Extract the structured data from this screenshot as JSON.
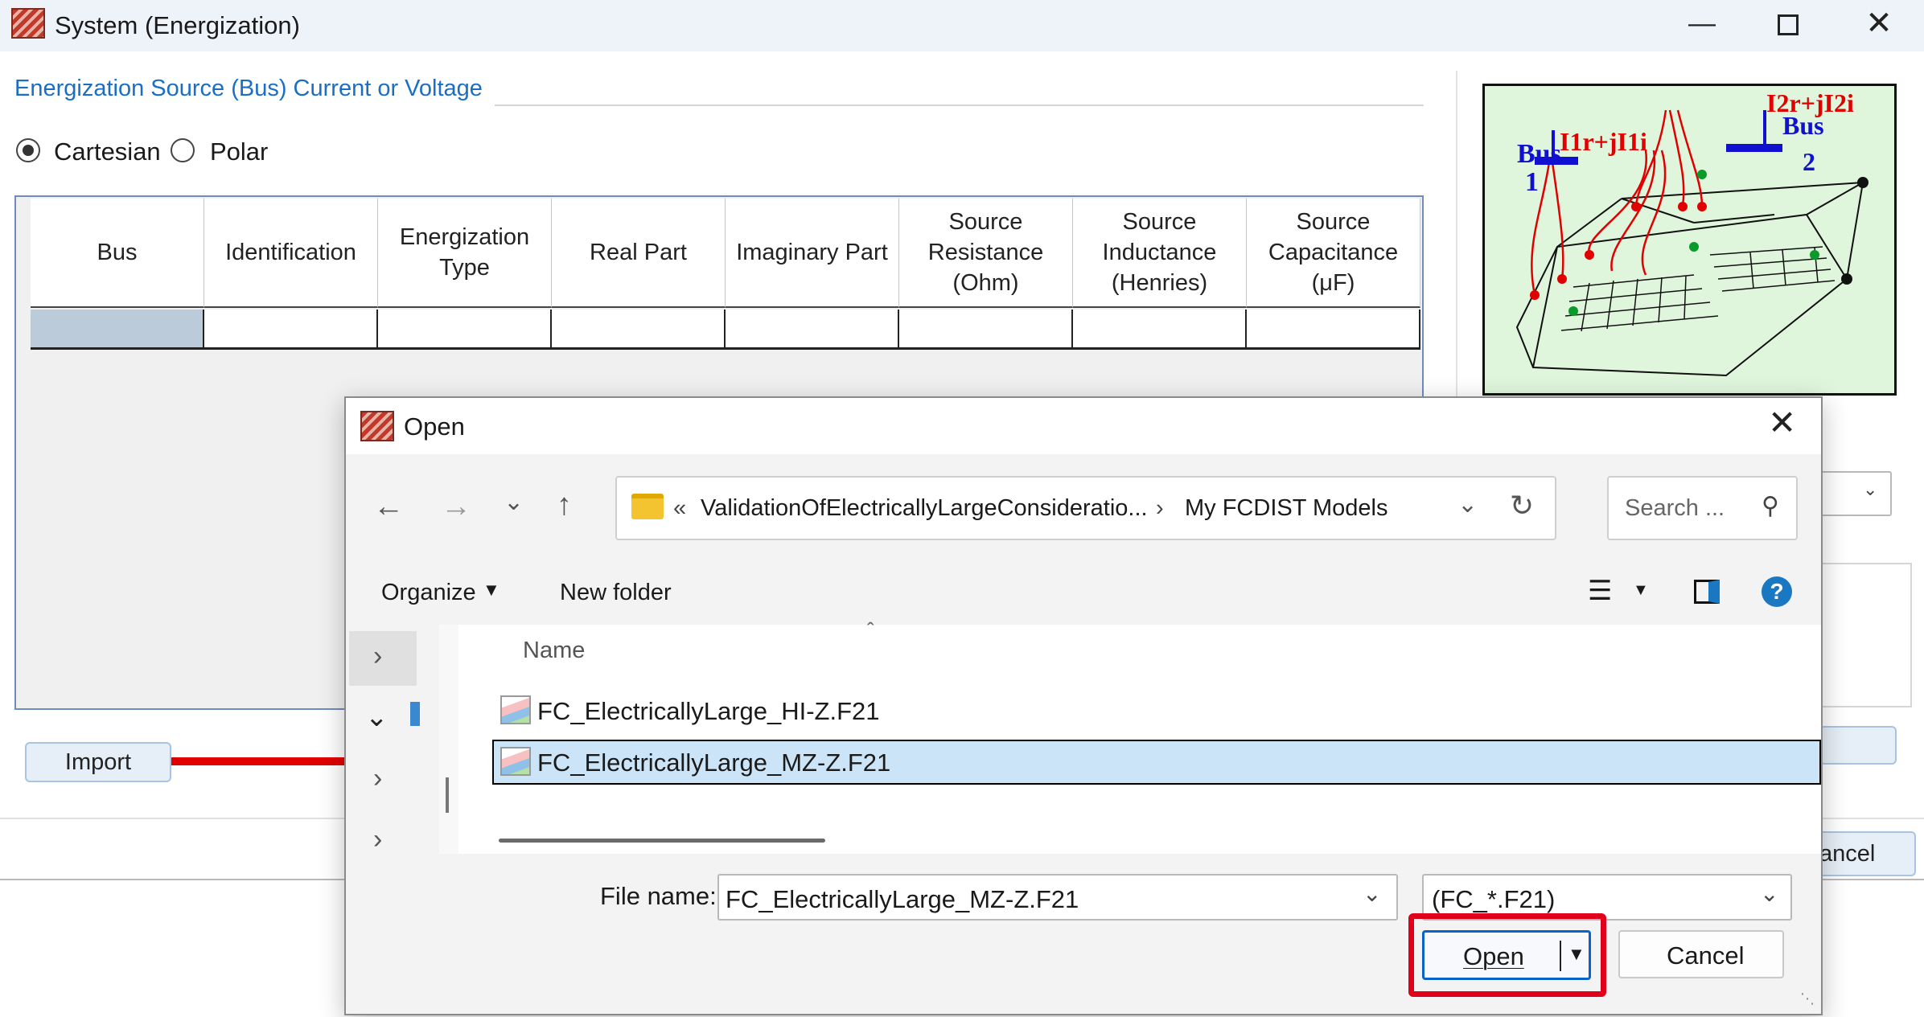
{
  "main_window": {
    "title": "System (Energization)",
    "group_label": "Energization Source (Bus) Current or Voltage",
    "radio_cartesian": "Cartesian",
    "radio_polar": "Polar",
    "selected_mode": "Cartesian",
    "columns": [
      "Bus",
      "Identification",
      "Energization Type",
      "Real Part",
      "Imaginary Part",
      "Source Resistance (Ohm)",
      "Source Inductance (Henries)",
      "Source Capacitance (μF)"
    ],
    "import_label": "Import",
    "cancel_partial": "ancel",
    "diagram": {
      "bus1": "Bus",
      "bus1_num": "1",
      "bus2": "Bus",
      "bus2_num": "2",
      "current1": "I1r+jI1i",
      "current2": "I2r+jI2i"
    }
  },
  "open_dialog": {
    "title": "Open",
    "breadcrumb_prefix": "«",
    "breadcrumb_folder": "ValidationOfElectricallyLargeConsideratio...",
    "breadcrumb_sep": "›",
    "breadcrumb_current": "My FCDIST Models",
    "search_placeholder": "Search ...",
    "organize_label": "Organize",
    "new_folder_label": "New folder",
    "name_header": "Name",
    "files": [
      {
        "name": "FC_ElectricallyLarge_HI-Z.F21",
        "selected": false
      },
      {
        "name": "FC_ElectricallyLarge_MZ-Z.F21",
        "selected": true
      }
    ],
    "filename_label": "File name:",
    "filename_value": "FC_ElectricallyLarge_MZ-Z.F21",
    "filter_value": "(FC_*.F21)",
    "open_button": "Open",
    "cancel_button": "Cancel"
  },
  "colors": {
    "accent_blue": "#1a6fc4",
    "highlight_red": "#e0001b",
    "selection_blue": "#cce4f7"
  }
}
